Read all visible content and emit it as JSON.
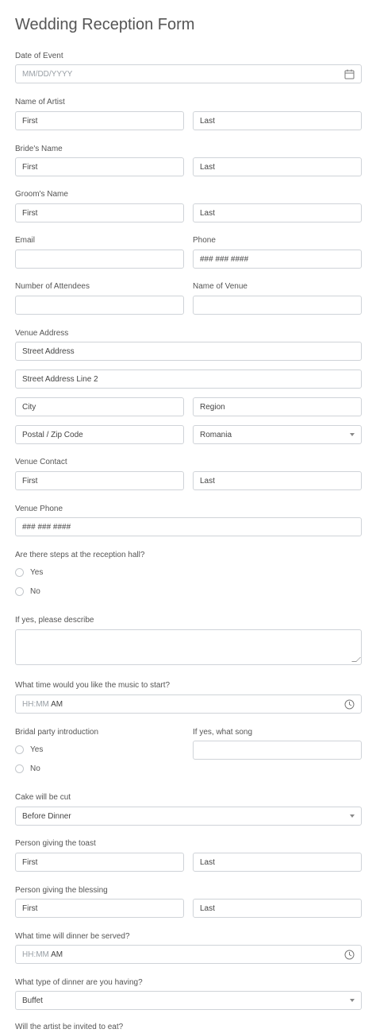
{
  "form": {
    "title": "Wedding Reception Form",
    "date_of_event": {
      "label": "Date of Event",
      "placeholder": "MM/DD/YYYY"
    },
    "artist": {
      "label": "Name of Artist",
      "first": "First",
      "last": "Last"
    },
    "bride": {
      "label": "Bride's Name",
      "first": "First",
      "last": "Last"
    },
    "groom": {
      "label": "Groom's Name",
      "first": "First",
      "last": "Last"
    },
    "email": {
      "label": "Email",
      "value": ""
    },
    "phone": {
      "label": "Phone",
      "placeholder": "### ### ####"
    },
    "attendees": {
      "label": "Number of Attendees",
      "value": ""
    },
    "venue_name": {
      "label": "Name of Venue",
      "value": ""
    },
    "venue_address": {
      "label": "Venue Address",
      "street": "Street Address",
      "street2": "Street Address Line 2",
      "city": "City",
      "region": "Region",
      "postal": "Postal / Zip Code",
      "country": "Romania"
    },
    "venue_contact": {
      "label": "Venue Contact",
      "first": "First",
      "last": "Last"
    },
    "venue_phone": {
      "label": "Venue Phone",
      "placeholder": "### ### ####"
    },
    "steps": {
      "label": "Are there steps at the reception hall?",
      "options": [
        "Yes",
        "No"
      ]
    },
    "steps_describe": {
      "label": "If yes, please describe"
    },
    "music_time": {
      "label": "What time would you like the music to start?",
      "placeholder": "HH:MM",
      "ampm": "AM"
    },
    "bridal_intro": {
      "label": "Bridal party introduction",
      "options": [
        "Yes",
        "No"
      ]
    },
    "bridal_song": {
      "label": "If yes, what song",
      "value": ""
    },
    "cake": {
      "label": "Cake will be cut",
      "value": "Before Dinner"
    },
    "toast": {
      "label": "Person giving the toast",
      "first": "First",
      "last": "Last"
    },
    "blessing": {
      "label": "Person giving the blessing",
      "first": "First",
      "last": "Last"
    },
    "dinner_time": {
      "label": "What time will dinner be served?",
      "placeholder": "HH:MM",
      "ampm": "AM"
    },
    "dinner_type": {
      "label": "What type of dinner are you having?",
      "value": "Buffet"
    },
    "next_question": {
      "label": "Will the artist be invited to eat?"
    }
  },
  "icons": {
    "calendar": "calendar-icon",
    "clock": "clock-icon",
    "dropdown": "chevron-down-icon"
  },
  "colors": {
    "border": "#cfd3d8",
    "text": "#444444",
    "label": "#555555",
    "placeholder": "#9aa0a6"
  }
}
